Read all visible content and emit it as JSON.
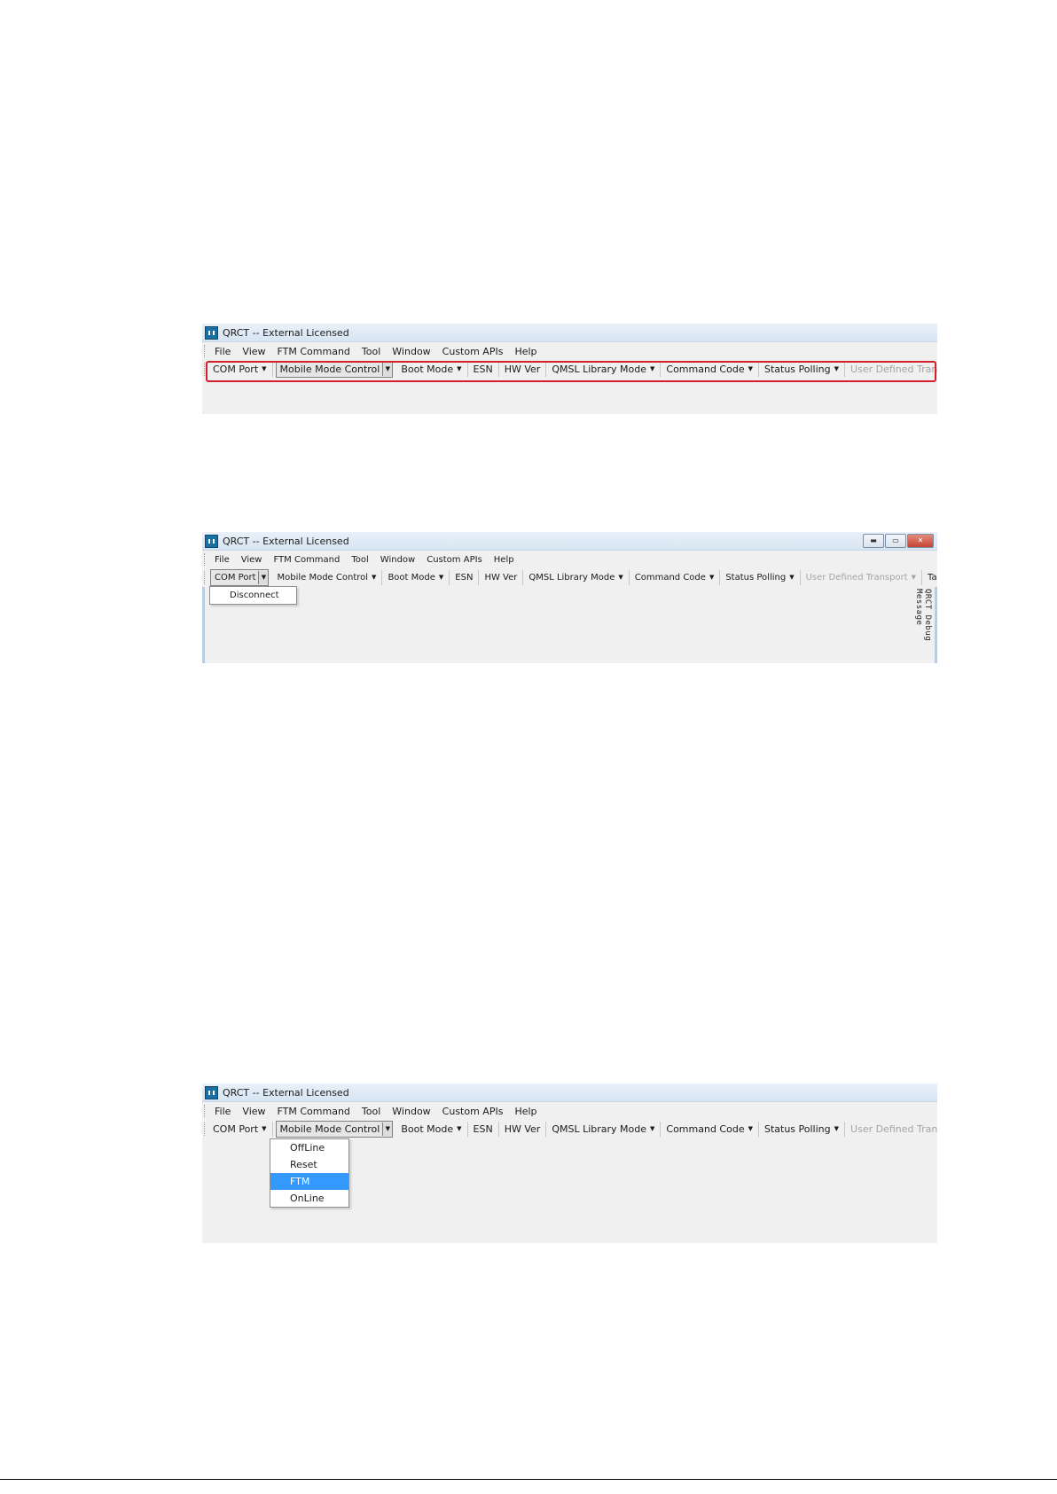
{
  "app": {
    "title": "QRCT -- External Licensed"
  },
  "menu": [
    "File",
    "View",
    "FTM Command",
    "Tool",
    "Window",
    "Custom APIs",
    "Help"
  ],
  "toolbar": {
    "com_port": "COM Port",
    "mobile_mode_control": "Mobile Mode Control",
    "boot_mode": "Boot Mode",
    "esn": "ESN",
    "hw_ver": "HW Ver",
    "qmsl_library_mode": "QMSL Library Mode",
    "command_code": "Command Code",
    "status_polling": "Status Polling",
    "user_defined_transport": "User Defined Transport",
    "target": "Target"
  },
  "com_port_menu": [
    "Disconnect"
  ],
  "mobile_mode_menu": {
    "items": [
      "OffLine",
      "Reset",
      "FTM",
      "OnLine"
    ],
    "selected": "FTM"
  },
  "debug_panel_label": "QRCT Debug Message",
  "colors": {
    "highlight_box": "#d4202e",
    "menu_selected": "#3399ff",
    "window_bg": "#f0f0f0"
  },
  "icons": {
    "app": "qrct-app-icon",
    "caret": "dropdown-caret-icon",
    "overflow": "toolbar-overflow-icon"
  }
}
